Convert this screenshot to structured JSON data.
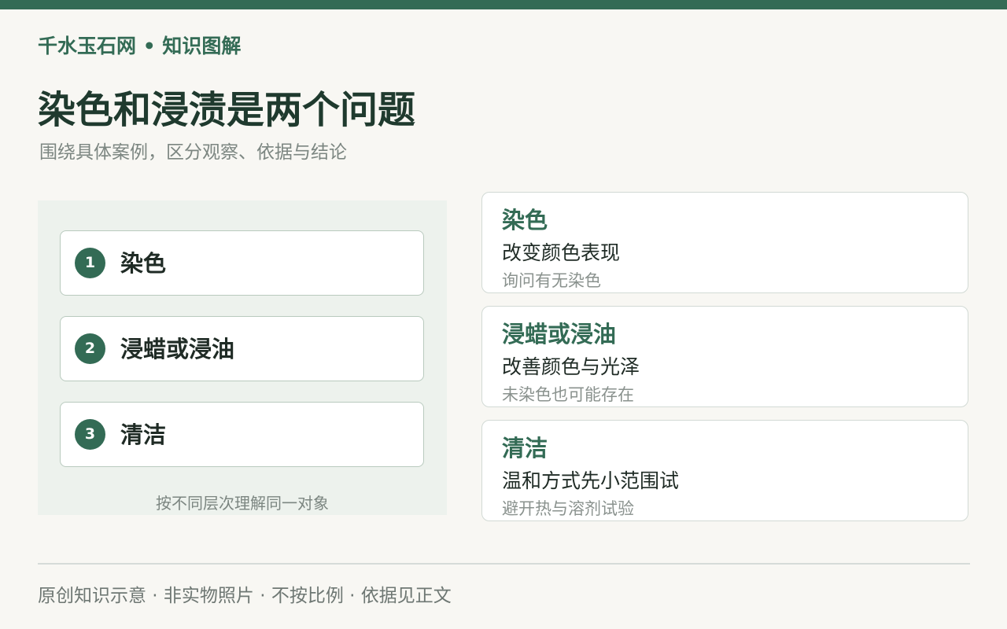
{
  "colors": {
    "accent": "#336b55",
    "background": "#f8f7f3",
    "panel": "#edf2ed"
  },
  "header": {
    "brand": "千水玉石网 • 知识图解",
    "title": "染色和浸渍是两个问题",
    "subtitle": "围绕具体案例，区分观察、依据与结论"
  },
  "steps": [
    {
      "number": "1",
      "label": "染色"
    },
    {
      "number": "2",
      "label": "浸蜡或浸油"
    },
    {
      "number": "3",
      "label": "清洁"
    }
  ],
  "panel_note": "按不同层次理解同一对象",
  "details": [
    {
      "title": "染色",
      "desc": "改变颜色表现",
      "note": "询问有无染色"
    },
    {
      "title": "浸蜡或浸油",
      "desc": "改善颜色与光泽",
      "note": "未染色也可能存在"
    },
    {
      "title": "清洁",
      "desc": "温和方式先小范围试",
      "note": "避开热与溶剂试验"
    }
  ],
  "footer": "原创知识示意 · 非实物照片 · 不按比例 · 依据见正文"
}
